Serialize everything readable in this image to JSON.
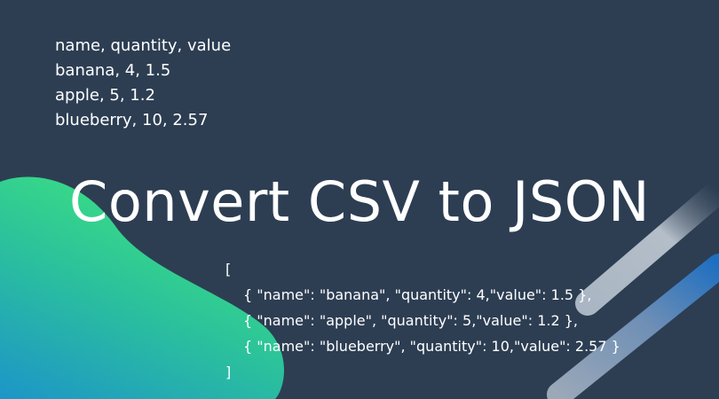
{
  "csv": {
    "lines": [
      "name, quantity, value",
      "banana, 4, 1.5",
      "apple, 5, 1.2",
      "blueberry, 10, 2.57"
    ]
  },
  "title": "Convert CSV to JSON",
  "json": {
    "open": "[",
    "items": [
      "{ \"name\": \"banana\", \"quantity\": 4,\"value\": 1.5 },",
      "{ \"name\": \"apple\", \"quantity\": 5,\"value\": 1.2 },",
      "{ \"name\": \"blueberry\", \"quantity\": 10,\"value\": 2.57 }"
    ],
    "close": "]"
  },
  "colors": {
    "background": "#2d3e53",
    "blob_green": "#3ee47e",
    "blob_blue": "#1d95c8",
    "stripe_light": "#9aa8b8",
    "stripe_blue": "#1f6fc0",
    "text": "#ffffff"
  }
}
